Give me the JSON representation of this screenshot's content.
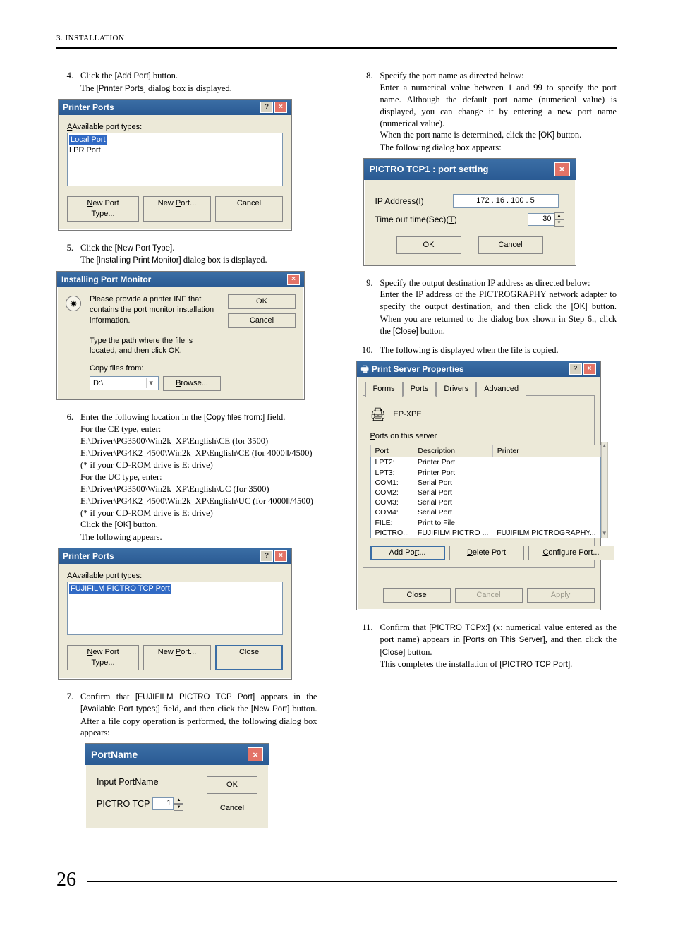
{
  "header": {
    "section": "3. INSTALLATION"
  },
  "pageNumber": "26",
  "left": {
    "step4": {
      "num": "4.",
      "text1a": "Click the ",
      "btn1": "[Add Port]",
      "text1b": " button.",
      "text2a": "The ",
      "dlg1": "[Printer Ports]",
      "text2b": " dialog box is displayed."
    },
    "printerPorts1": {
      "title": "Printer Ports",
      "label": "Available port types:",
      "item1": "Local Port",
      "item2": "LPR Port",
      "newType": "New Port Type...",
      "newPort": "New Port...",
      "cancel": "Cancel"
    },
    "step5": {
      "num": "5.",
      "text1a": "Click the ",
      "btn1": "[New Port Type]",
      "text1b": ".",
      "text2a": "The ",
      "dlg1": "[Installing Print Monitor]",
      "text2b": " dialog box is displayed."
    },
    "installMon": {
      "title": "Installing Port Monitor",
      "msg": "Please provide a printer INF that contains the port monitor installation information.",
      "msg2": "Type the path where the file is located, and then click OK.",
      "copyFrom": "Copy files from:",
      "pathValue": "D:\\",
      "ok": "OK",
      "cancel": "Cancel",
      "browse": "Browse..."
    },
    "step6": {
      "num": "6.",
      "l1a": "Enter the following location in the ",
      "l1b": "[Copy files from:]",
      "l1c": " field.",
      "l2": "For the CE type, enter:",
      "l3": "E:\\Driver\\PG3500\\Win2k_XP\\English\\CE (for 3500)",
      "l4": "E:\\Driver\\PG4K2_4500\\Win2k_XP\\English\\CE (for 4000Ⅱ/4500)",
      "l5": "(* if your CD-ROM drive is E: drive)",
      "l6": "For the UC type, enter:",
      "l7": "E:\\Driver\\PG3500\\Win2k_XP\\English\\UC  (for 3500)",
      "l8": "E:\\Driver\\PG4K2_4500\\Win2k_XP\\English\\UC (for 4000Ⅱ/4500)",
      "l9": "(* if your CD-ROM drive is E: drive)",
      "l10a": "Click the ",
      "l10b": "[OK]",
      "l10c": " button.",
      "l11": "The following appears."
    },
    "printerPorts2": {
      "title": "Printer Ports",
      "label": "Available port types:",
      "item1": "FUJIFILM PICTRO TCP Port",
      "newType": "New Port Type...",
      "newPort": "New Port...",
      "close": "Close"
    },
    "step7": {
      "num": "7.",
      "l1a": "Confirm that ",
      "l1b": "[FUJIFILM PICTRO TCP Port]",
      "l1c": " appears in the ",
      "l2a": "[Available Port types;]",
      "l2b": " field, and then click the ",
      "l2c": "[New Port]",
      "l2d": " button.   After a file copy operation is performed, the following dialog box appears:"
    },
    "portName": {
      "title": "PortName",
      "label": "Input PortName",
      "prefix": "PICTRO TCP",
      "value": "1",
      "ok": "OK",
      "cancel": "Cancel"
    }
  },
  "right": {
    "step8": {
      "num": "8.",
      "l1": "Specify the port name as directed below:",
      "l2": "Enter a numerical value between 1 and 99 to specify the port name.  Although the default port name (numerical value) is displayed, you can change it by entering a new port name (numerical value).",
      "l3a": "When the port name is determined, click the ",
      "l3b": "[OK]",
      "l3c": " button.",
      "l4": "The following dialog box appears:"
    },
    "portSetting": {
      "title": "PICTRO TCP1 : port setting",
      "ipLabel": "IP Address(I)",
      "ipValue": "172 . 16 . 100 .  5",
      "toLabel": "Time out time(Sec)(T)",
      "toValue": "30",
      "ok": "OK",
      "cancel": "Cancel"
    },
    "step9": {
      "num": "9.",
      "l1": "Specify the output destination IP address as directed below:",
      "l2a": "Enter the IP address of the PICTROGRAPHY network adapter to specify the output destination, and then click the ",
      "l2b": "[OK]",
      "l2c": " button.",
      "l3a": "When you are returned to the dialog box shown in Step 6., click the ",
      "l3b": "[Close]",
      "l3c": " button."
    },
    "step10": {
      "num": "10.",
      "l1": "The following is displayed when the file is copied."
    },
    "serverProps": {
      "title": "Print Server Properties",
      "tabs": {
        "forms": "Forms",
        "ports": "Ports",
        "drivers": "Drivers",
        "advanced": "Advanced"
      },
      "host": "EP-XPE",
      "portsOn": "Ports on this server",
      "headers": {
        "port": "Port",
        "desc": "Description",
        "printer": "Printer"
      },
      "rows": [
        {
          "p": "LPT2:",
          "d": "Printer Port",
          "pr": ""
        },
        {
          "p": "LPT3:",
          "d": "Printer Port",
          "pr": ""
        },
        {
          "p": "COM1:",
          "d": "Serial Port",
          "pr": ""
        },
        {
          "p": "COM2:",
          "d": "Serial Port",
          "pr": ""
        },
        {
          "p": "COM3:",
          "d": "Serial Port",
          "pr": ""
        },
        {
          "p": "COM4:",
          "d": "Serial Port",
          "pr": ""
        },
        {
          "p": "FILE:",
          "d": "Print to File",
          "pr": ""
        },
        {
          "p": "PICTRO...",
          "d": "FUJIFILM PICTRO ...",
          "pr": "FUJIFILM PICTROGRAPHY..."
        }
      ],
      "addPort": "Add Port...",
      "delPort": "Delete Port",
      "cfgPort": "Configure Port...",
      "close": "Close",
      "cancel": "Cancel",
      "apply": "Apply"
    },
    "step11": {
      "num": "11.",
      "l1a": "Confirm that ",
      "l1b": "[PICTRO TCPx:]",
      "l1c": " (x: numerical value entered as the port name) appears in ",
      "l1d": "[Ports on This Server]",
      "l1e": ", and then click the ",
      "l1f": "[Close]",
      "l1g": " button.",
      "l2a": "This completes the installation of ",
      "l2b": "[PICTRO TCP Port]",
      "l2c": "."
    }
  }
}
